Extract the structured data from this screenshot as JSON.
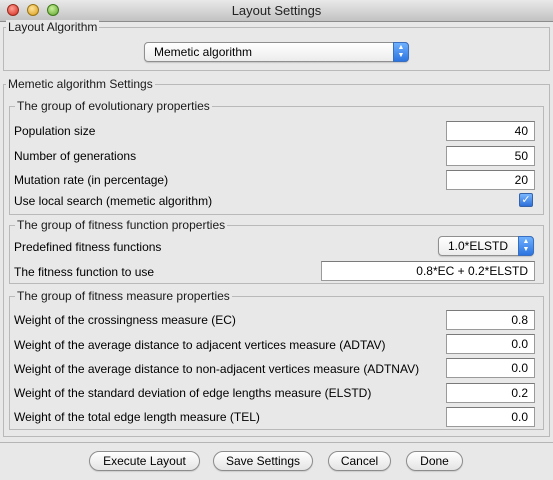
{
  "window": {
    "title": "Layout Settings"
  },
  "layout_algorithm": {
    "group_title": "Layout Algorithm",
    "selected": "Memetic algorithm"
  },
  "settings": {
    "group_title": "Memetic algorithm Settings",
    "evolutionary": {
      "title": "The group of evolutionary properties",
      "population_label": "Population size",
      "population_value": "40",
      "generations_label": "Number of generations",
      "generations_value": "50",
      "mutation_label": "Mutation rate (in percentage)",
      "mutation_value": "20",
      "local_search_label": "Use local search (memetic algorithm)",
      "local_search_checked": true
    },
    "fitness_function": {
      "title": "The group of fitness function properties",
      "predefined_label": "Predefined fitness functions",
      "predefined_value": "1.0*ELSTD",
      "function_label": "The fitness function to use",
      "function_value": "0.8*EC + 0.2*ELSTD"
    },
    "fitness_measure": {
      "title": "The group of fitness measure properties",
      "ec_label": "Weight of the crossingness measure (EC)",
      "ec_value": "0.8",
      "adtav_label": "Weight of the average distance to adjacent vertices measure (ADTAV)",
      "adtav_value": "0.0",
      "adtnav_label": "Weight of the average distance to non-adjacent vertices measure (ADTNAV)",
      "adtnav_value": "0.0",
      "elstd_label": "Weight of the standard deviation of edge lengths measure (ELSTD)",
      "elstd_value": "0.2",
      "tel_label": "Weight of the total edge length measure (TEL)",
      "tel_value": "0.0"
    }
  },
  "buttons": {
    "execute": "Execute Layout",
    "save": "Save Settings",
    "cancel": "Cancel",
    "done": "Done"
  },
  "icons": {
    "popup_arrows": "updown-arrows-icon",
    "check": "checkmark-icon"
  },
  "colors": {
    "accent": "#2c74e0",
    "window_bg": "#e8e8e8"
  }
}
